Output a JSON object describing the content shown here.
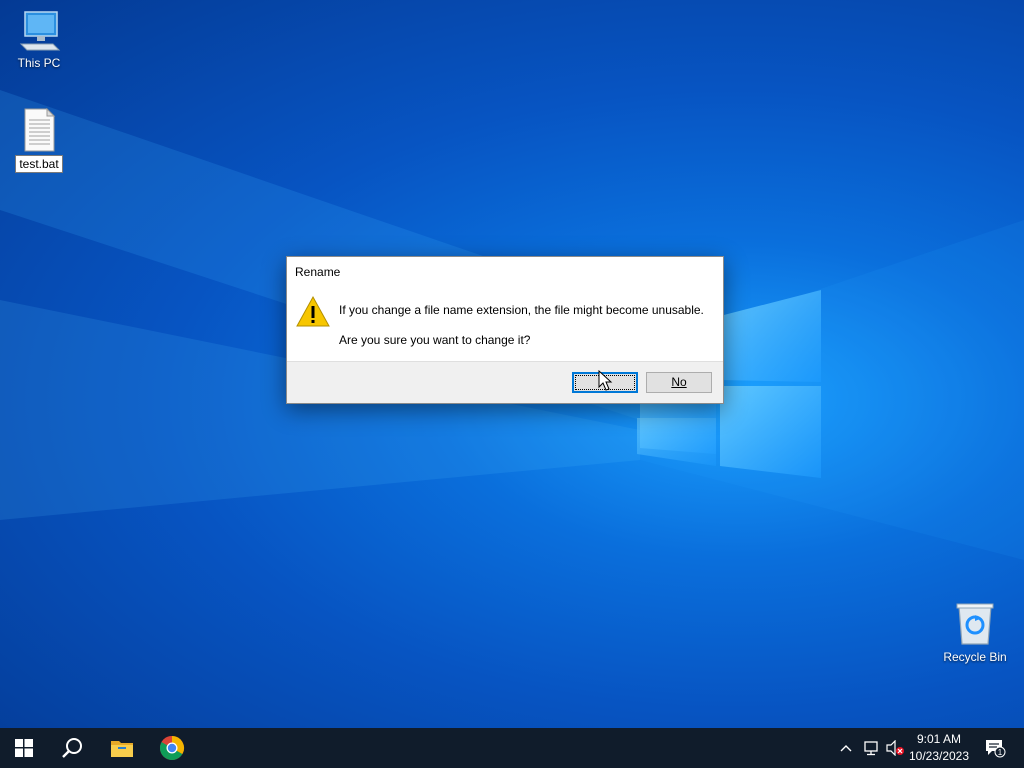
{
  "desktop": {
    "icons": [
      {
        "label": "This PC",
        "icon": "computer-icon"
      },
      {
        "label": "test.bat",
        "icon": "file-icon"
      },
      {
        "label": "Recycle Bin",
        "icon": "recycle-bin-icon"
      }
    ]
  },
  "dialog": {
    "title": "Rename",
    "icon": "warning-icon",
    "message": "If you change a file name extension, the file might become unusable.",
    "question": "Are you sure you want to change it?",
    "yes_label": "",
    "no_label": "No"
  },
  "taskbar": {
    "start": "windows-start-icon",
    "search": "search-icon",
    "pinned": [
      "file-explorer-icon",
      "chrome-icon"
    ],
    "tray_icons": [
      "chevron-up-icon",
      "network-icon",
      "volume-muted-icon",
      "notifications-icon"
    ],
    "time": "9:01 AM",
    "date": "10/23/2023",
    "notification_count": "1"
  },
  "colors": {
    "desktop_bg": "#0a6fdc",
    "taskbar_bg": "#101c2b",
    "accent": "#0078d7",
    "warning": "#f7c600"
  }
}
